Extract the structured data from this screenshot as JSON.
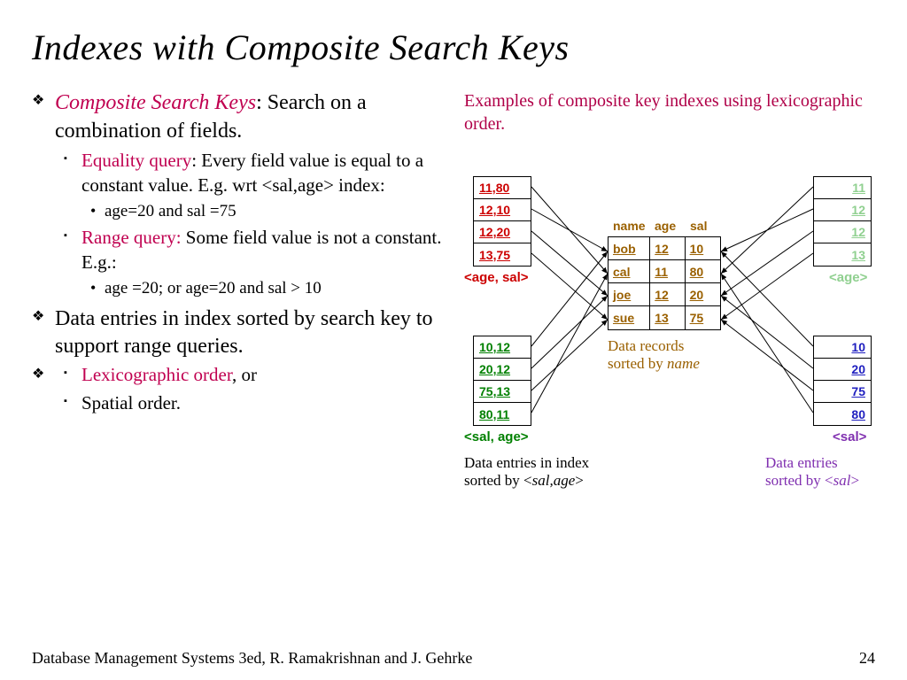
{
  "title": "Indexes with Composite Search Keys",
  "bullets": {
    "b1_accent": "Composite Search Keys",
    "b1_rest": ": Search on a combination of fields.",
    "b1a_accent": "Equality query",
    "b1a_rest": ": Every field value is equal to a constant value. E.g. wrt <sal,age> index:",
    "b1a1": "age=20 and sal =75",
    "b1b_accent": "Range query:",
    "b1b_rest": " Some field value is not a constant. E.g.:",
    "b1b1": "age =20; or age=20 and sal > 10",
    "b2": "Data entries in index sorted by search key to support range queries.",
    "b2a_accent": "Lexicographic order",
    "b2a_rest": ", or",
    "b2b": "Spatial order."
  },
  "right_header": "Examples of composite key indexes using lexicographic order.",
  "diagram": {
    "age_sal": {
      "rows": [
        "11,80",
        "12,10",
        "12,20",
        "13,75"
      ],
      "label": "<age, sal>"
    },
    "sal_age": {
      "rows": [
        "10,12",
        "20,12",
        "75,13",
        "80,11"
      ],
      "label": "<sal, age>"
    },
    "age": {
      "rows": [
        "11",
        "12",
        "12",
        "13"
      ],
      "label": "<age>"
    },
    "sal": {
      "rows": [
        "10",
        "20",
        "75",
        "80"
      ],
      "label": "<sal>"
    },
    "center_header": {
      "c1": "name",
      "c2": "age",
      "c3": "sal"
    },
    "center_rows": [
      {
        "c1": "bob",
        "c2": "12",
        "c3": "10"
      },
      {
        "c1": "cal",
        "c2": "11",
        "c3": "80"
      },
      {
        "c1": "joe",
        "c2": "12",
        "c3": "20"
      },
      {
        "c1": "sue",
        "c2": "13",
        "c3": "75"
      }
    ],
    "center_caption1": "Data records",
    "center_caption2": "sorted by ",
    "center_caption2_ital": "name",
    "bl_caption1": "Data entries in index",
    "bl_caption2a": "sorted by <",
    "bl_caption2b": "sal,age",
    "bl_caption2c": ">",
    "br_caption1": "Data entries",
    "br_caption2a": "sorted by <",
    "br_caption2b": "sal",
    "br_caption2c": ">"
  },
  "footer_left": "Database Management Systems 3ed, R. Ramakrishnan and J. Gehrke",
  "footer_right": "24"
}
